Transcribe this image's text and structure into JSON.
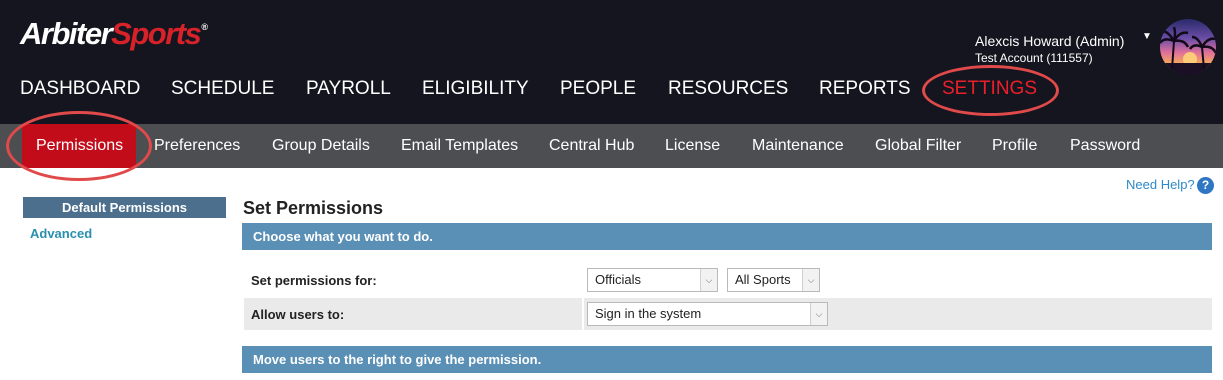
{
  "brand": {
    "part1": "Arbiter",
    "part2": "Sports",
    "reg": "®"
  },
  "user": {
    "name": "Alexcis Howard (Admin)",
    "account": "Test Account (111557)",
    "caret": "▼"
  },
  "main_nav": [
    {
      "label": "DASHBOARD"
    },
    {
      "label": "SCHEDULE"
    },
    {
      "label": "PAYROLL"
    },
    {
      "label": "ELIGIBILITY"
    },
    {
      "label": "PEOPLE"
    },
    {
      "label": "RESOURCES"
    },
    {
      "label": "REPORTS"
    },
    {
      "label": "SETTINGS",
      "active": true
    }
  ],
  "sub_nav": [
    {
      "label": "Permissions",
      "active": true
    },
    {
      "label": "Preferences"
    },
    {
      "label": "Group Details"
    },
    {
      "label": "Email Templates"
    },
    {
      "label": "Central Hub"
    },
    {
      "label": "License"
    },
    {
      "label": "Maintenance"
    },
    {
      "label": "Global Filter"
    },
    {
      "label": "Profile"
    },
    {
      "label": "Password"
    }
  ],
  "help": {
    "label": "Need Help?",
    "icon": "help-icon"
  },
  "sidebar": {
    "heading": "Default Permissions",
    "link": "Advanced"
  },
  "main": {
    "title": "Set Permissions",
    "band1": "Choose what you want to do.",
    "row1": {
      "label": "Set permissions for:",
      "select1": "Officials",
      "select2": "All Sports"
    },
    "row2": {
      "label": "Allow users to:",
      "select": "Sign in the system"
    },
    "band2": "Move users to the right to give the permission."
  },
  "colors": {
    "header_bg": "#15151f",
    "subnav_bg": "#4d4e52",
    "active_tab": "#c20c1a",
    "accent_red": "#ec1f2b",
    "band_blue": "#5a8fb6",
    "sidebar_head": "#4d6f8e",
    "link": "#2a8fae",
    "annotation_ring": "#e04a4a"
  }
}
